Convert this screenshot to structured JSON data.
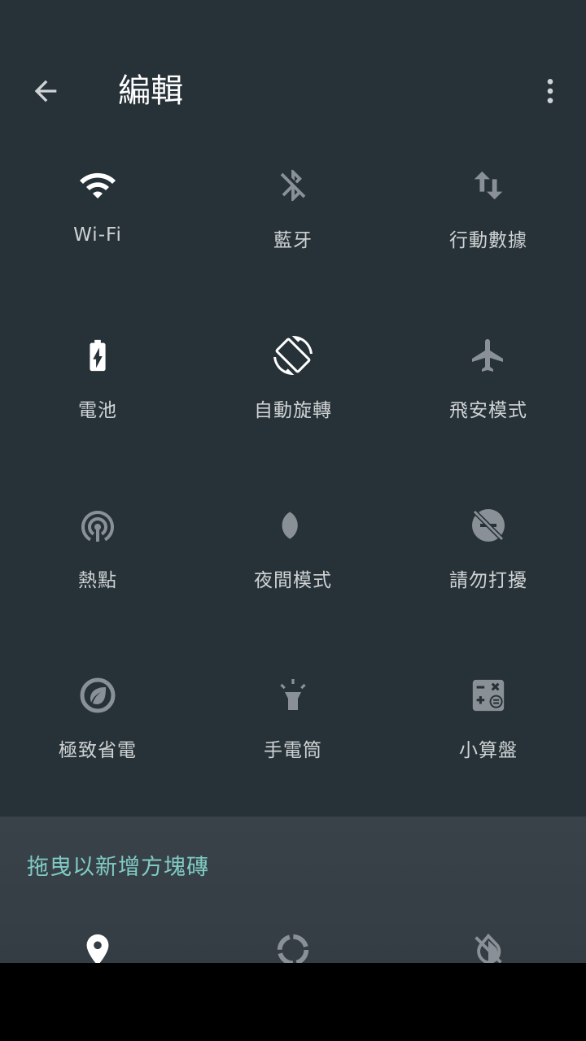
{
  "toolbar": {
    "title": "編輯",
    "back_icon": "arrow-back-icon",
    "more_icon": "more-vert-icon"
  },
  "tiles": [
    {
      "label": "Wi-Fi",
      "icon": "wifi-icon"
    },
    {
      "label": "藍牙",
      "icon": "bluetooth-disabled-icon"
    },
    {
      "label": "行動數據",
      "icon": "mobile-data-icon"
    },
    {
      "label": "電池",
      "icon": "battery-charging-icon"
    },
    {
      "label": "自動旋轉",
      "icon": "auto-rotate-icon"
    },
    {
      "label": "飛安模式",
      "icon": "airplane-icon"
    },
    {
      "label": "熱點",
      "icon": "hotspot-icon"
    },
    {
      "label": "夜間模式",
      "icon": "moon-icon"
    },
    {
      "label": "請勿打擾",
      "icon": "do-not-disturb-icon"
    },
    {
      "label": "極致省電",
      "icon": "battery-saver-leaf-icon"
    },
    {
      "label": "手電筒",
      "icon": "flashlight-icon"
    },
    {
      "label": "小算盤",
      "icon": "calculator-icon"
    }
  ],
  "drag_section": {
    "title": "拖曳以新增方塊磚",
    "tiles": [
      {
        "icon": "location-icon"
      },
      {
        "icon": "sync-icon"
      },
      {
        "icon": "invert-colors-off-icon"
      }
    ]
  },
  "colors": {
    "background": "#263238",
    "active_icon": "#ffffff",
    "inactive_icon": "#8a9196",
    "accent": "#80cbc4"
  }
}
